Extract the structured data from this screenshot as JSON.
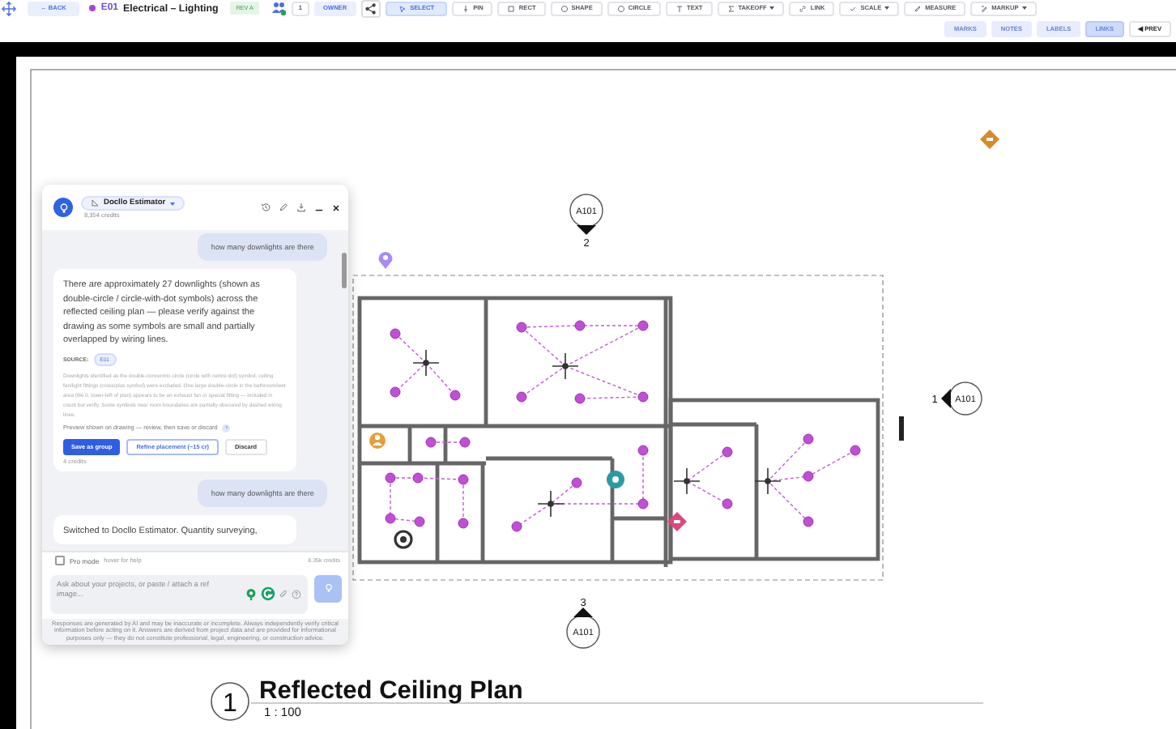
{
  "toolbar": {
    "back": "← BACK",
    "sheet_code": "E01",
    "sheet_title": "Electrical – Lighting",
    "revision": "REV A",
    "member_count": "1",
    "role": "OWNER",
    "tools": [
      {
        "label": "SELECT",
        "selected": true,
        "dropdown": false
      },
      {
        "label": "PIN",
        "selected": false,
        "dropdown": false
      },
      {
        "label": "RECT",
        "selected": false,
        "dropdown": false
      },
      {
        "label": "SHAPE",
        "selected": false,
        "dropdown": false
      },
      {
        "label": "CIRCLE",
        "selected": false,
        "dropdown": false
      },
      {
        "label": "TEXT",
        "selected": false,
        "dropdown": false
      },
      {
        "label": "TAKEOFF",
        "selected": false,
        "dropdown": true
      },
      {
        "label": "LINK",
        "selected": false,
        "dropdown": false
      },
      {
        "label": "SCALE",
        "selected": false,
        "dropdown": true
      },
      {
        "label": "MEASURE",
        "selected": false,
        "dropdown": false
      },
      {
        "label": "MARKUP",
        "selected": false,
        "dropdown": true
      }
    ]
  },
  "view_toggles": [
    {
      "label": "MARKS",
      "selected": false
    },
    {
      "label": "NOTES",
      "selected": false
    },
    {
      "label": "LABELS",
      "selected": false
    },
    {
      "label": "LINKS",
      "selected": true
    }
  ],
  "prev": "◀ PREV",
  "drawing": {
    "section_markers": [
      {
        "sheet": "A101",
        "number": "2"
      },
      {
        "sheet": "A101",
        "number": "1"
      },
      {
        "sheet": "A101",
        "number": "3"
      }
    ],
    "title": {
      "number": "1",
      "name": "Reflected Ceiling Plan",
      "scale": "1 : 100"
    }
  },
  "chat": {
    "assistant": "Docllo Estimator",
    "credits": "8,354 credits",
    "messages": [
      {
        "kind": "user",
        "text": "how many downlights are there"
      },
      {
        "kind": "assistant",
        "text": "There are approximately 27 downlights (shown as double-circle / circle-with-dot symbols) across the reflected ceiling plan — please verify against the drawing as some symbols are small and partially overlapped by wiring lines.",
        "source_label": "SOURCE:",
        "source": "E01",
        "detail": "Downlights identified as the double-concentric-circle (circle with centre dot) symbol; ceiling fan/light fittings (cross/plus symbol) were excluded. One large double-circle in the bathroom/wet area (tile 0, lower-left of plan) appears to be an exhaust fan or special fitting — included in count but verify. Some symbols near room boundaries are partially obscured by dashed wiring lines.",
        "preview": "Preview shown on drawing — review, then save or discard",
        "help": "?",
        "actions": [
          {
            "label": "Save as group",
            "kind": "primary"
          },
          {
            "label": "Refine placement (~15 cr)",
            "kind": "outline"
          },
          {
            "label": "Discard",
            "kind": "plain"
          }
        ],
        "cost": "4 credits"
      },
      {
        "kind": "user",
        "text": "how many downlights are there"
      },
      {
        "kind": "assistant",
        "text": "Switched to Docllo Estimator. Quantity surveying,"
      }
    ],
    "pro_mode": {
      "label": "Pro mode",
      "checked": false,
      "hint": "hover for help"
    },
    "balance": "8.35k credits",
    "input": {
      "placeholder": "Ask about your projects, or paste / attach a ref\nimage..."
    },
    "disclaimer": "Responses are generated by AI and may be inaccurate or incomplete. Always independently verify critical information before acting on it. Answers are derived from project data and are provided for informational purposes only — they do not constitute professional, legal, engineering, or construction advice."
  }
}
